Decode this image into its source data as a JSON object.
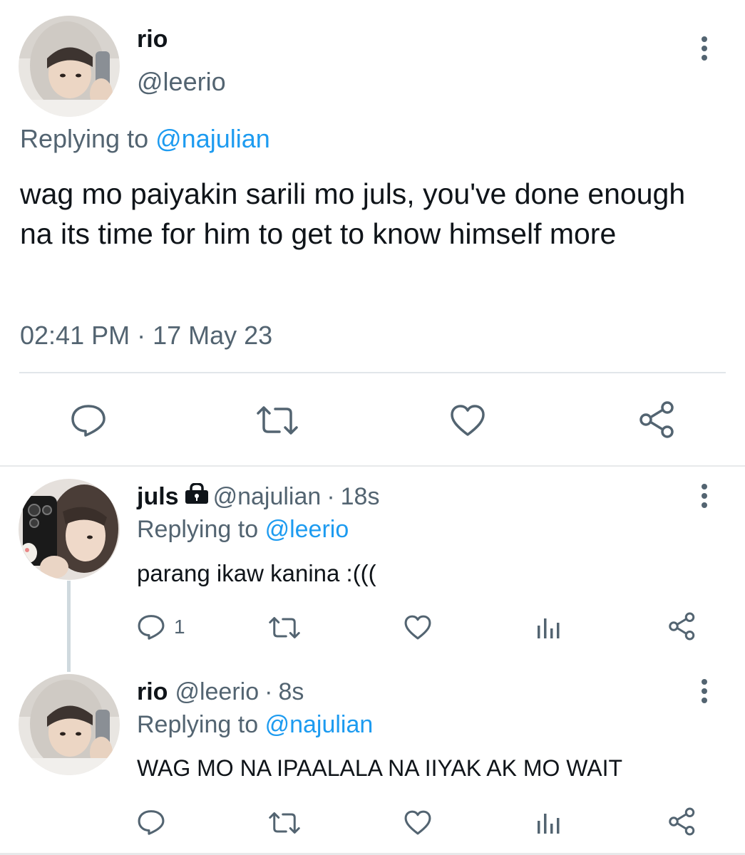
{
  "main_tweet": {
    "author_name": "rio",
    "author_handle": "@leerio",
    "replying_prefix": "Replying to",
    "replying_handle": "@najulian",
    "text": "wag mo paiyakin sarili mo juls, you've done enough na its time for him to get to know himself more",
    "timestamp": "02:41 PM · 17 May 23",
    "actions": [
      "reply-icon",
      "retweet-icon",
      "like-icon",
      "share-icon"
    ]
  },
  "replies": [
    {
      "author_name": "juls",
      "locked": true,
      "author_handle": "@najulian",
      "separator": "·",
      "age": "18s",
      "replying_prefix": "Replying to",
      "replying_handle": "@leerio",
      "text": "parang ikaw kanina :(((",
      "reply_count": "1"
    },
    {
      "author_name": "rio",
      "locked": false,
      "author_handle": "@leerio",
      "separator": "·",
      "age": "8s",
      "replying_prefix": "Replying to",
      "replying_handle": "@najulian",
      "text": "WAG MO NA IPAALALA NA IIYAK AK MO WAIT",
      "reply_count": ""
    }
  ],
  "colors": {
    "text": "#0f1419",
    "muted": "#536471",
    "link": "#1d9bf0",
    "divider": "#e7e9ea"
  }
}
